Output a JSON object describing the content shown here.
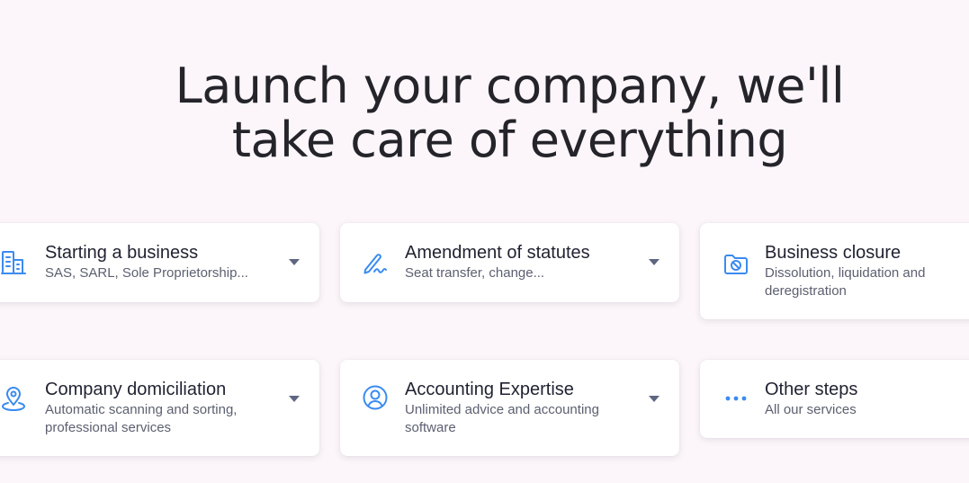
{
  "hero": {
    "title_line1": "Launch your company, we'll",
    "title_line2": "take care of everything"
  },
  "services": [
    {
      "title": "Starting a business",
      "subtitle": "SAS, SARL, Sole Proprietorship...",
      "icon": "building-icon",
      "expandable": true
    },
    {
      "title": "Amendment of statutes",
      "subtitle": "Seat transfer, change...",
      "icon": "pen-signature-icon",
      "expandable": true
    },
    {
      "title": "Business closure",
      "subtitle": "Dissolution, liquidation and deregistration",
      "icon": "folder-blocked-icon",
      "expandable": false
    },
    {
      "title": "Company domiciliation",
      "subtitle": "Automatic scanning and sorting, professional services",
      "icon": "location-pin-icon",
      "expandable": true
    },
    {
      "title": "Accounting Expertise",
      "subtitle": "Unlimited advice and accounting software",
      "icon": "user-circle-icon",
      "expandable": true
    },
    {
      "title": "Other steps",
      "subtitle": "All our services",
      "icon": "more-dots-icon",
      "expandable": false
    }
  ],
  "colors": {
    "background": "#fcf6fa",
    "icon_accent": "#3b8bf0",
    "chevron": "#5f6680"
  }
}
